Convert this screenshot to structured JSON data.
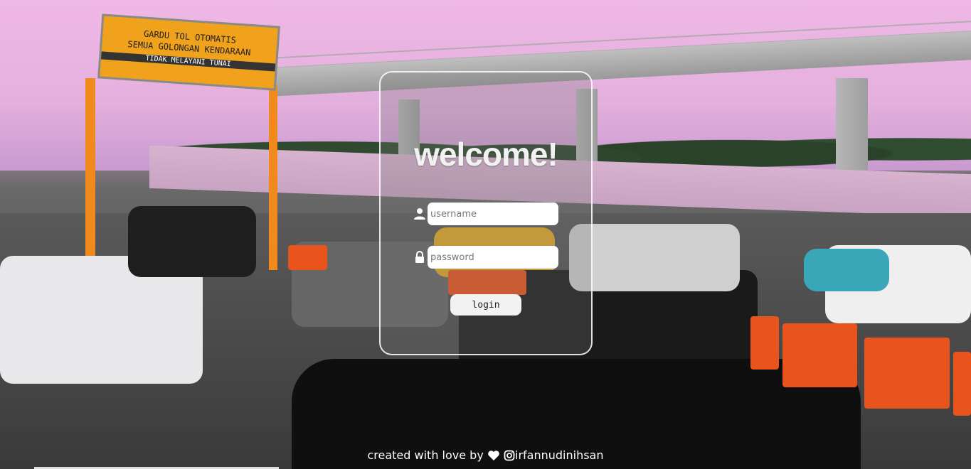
{
  "login": {
    "heading": "welcome!",
    "username_placeholder": "username",
    "password_placeholder": "password",
    "login_label": "login"
  },
  "footer": {
    "prefix": "created with love by",
    "handle": "irfannudinihsan"
  },
  "icons": {
    "username": "user-icon",
    "password": "lock-icon",
    "love": "heart-icon",
    "social": "instagram-icon"
  },
  "background": {
    "sign_line1": "GARDU TOL OTOMATIS",
    "sign_line2": "SEMUA GOLONGAN KENDARAAN",
    "sign_line3": "TIDAK MELAYANI TUNAI"
  }
}
